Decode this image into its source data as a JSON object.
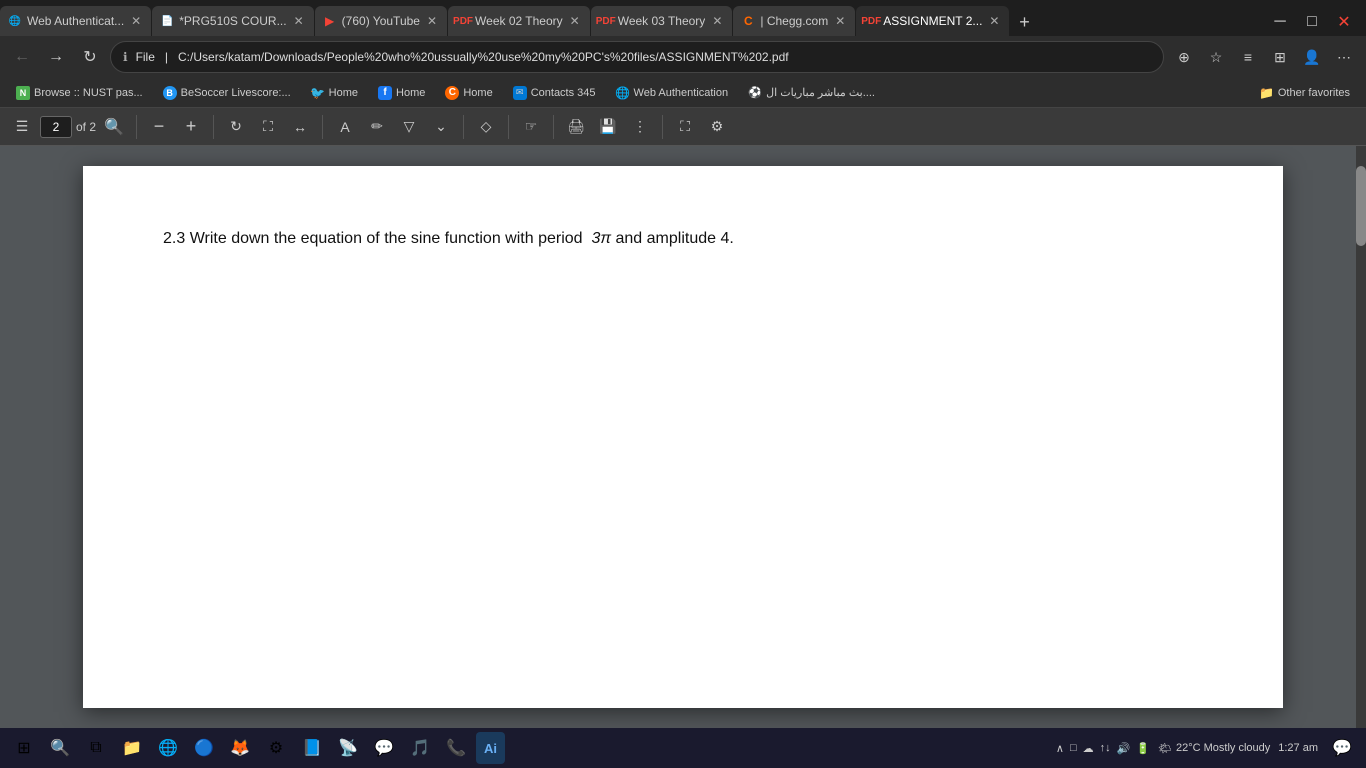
{
  "browser": {
    "tabs": [
      {
        "id": "tab1",
        "label": "Web Authenticat...",
        "icon": "🌐",
        "icon_color": "#4caf50",
        "active": false,
        "closable": true
      },
      {
        "id": "tab2",
        "label": "*PRG510S COUR...",
        "icon": "📄",
        "icon_color": "#aaa",
        "active": false,
        "closable": true
      },
      {
        "id": "tab3",
        "label": "(760) YouTube",
        "icon": "▶",
        "icon_color": "#f44336",
        "active": false,
        "closable": true
      },
      {
        "id": "tab4",
        "label": "Week 02 Theory",
        "icon": "PDF",
        "icon_color": "#f44336",
        "active": false,
        "closable": true
      },
      {
        "id": "tab5",
        "label": "Week 03 Theory",
        "icon": "PDF",
        "icon_color": "#f44336",
        "active": false,
        "closable": true
      },
      {
        "id": "tab6",
        "label": "| Chegg.com",
        "icon": "C",
        "icon_color": "#ff6600",
        "active": false,
        "closable": true
      },
      {
        "id": "tab7",
        "label": "ASSIGNMENT 2...",
        "icon": "PDF",
        "icon_color": "#f44336",
        "active": true,
        "closable": true
      }
    ],
    "url": "C:/Users/katam/Downloads/People%20who%20ussually%20use%20my%20PC's%20files/ASSIGNMENT%202.pdf",
    "url_display": "File   |   C:/Users/katam/Downloads/People%20who%20ussually%20use%20my%20PC's%20files/ASSIGNMENT%202.pdf"
  },
  "bookmarks": [
    {
      "label": "Browse :: NUST pas...",
      "icon": "N",
      "color": "#4caf50"
    },
    {
      "label": "BeSoccer Livescore:...",
      "icon": "B",
      "color": "#2196f3"
    },
    {
      "label": "Home",
      "icon": "🐦",
      "color": "#1da1f2"
    },
    {
      "label": "Home",
      "icon": "f",
      "color": "#1877f2"
    },
    {
      "label": "Home",
      "icon": "C",
      "color": "#ff6600"
    },
    {
      "label": "Contacts 345",
      "icon": "📧",
      "color": "#0078d4"
    },
    {
      "label": "Web Authentication",
      "icon": "🌐",
      "color": "#4caf50"
    },
    {
      "label": "بث مباشر مباريات ال....",
      "icon": "⚽",
      "color": "#4caf50"
    },
    {
      "label": "Other favorites",
      "icon": "📁",
      "color": "#f9a825"
    }
  ],
  "pdf_viewer": {
    "current_page": "2",
    "total_pages": "of 2",
    "zoom_minus": "−",
    "zoom_plus": "+",
    "content": {
      "question_number": "2.3",
      "question_text": "Write down the equation of the sine function with period ",
      "period_value": "3π",
      "question_end": " and amplitude 4."
    }
  },
  "taskbar": {
    "start_icon": "⊞",
    "search_icon": "🔍",
    "task_view": "⧉",
    "pinned_apps": [
      "📁",
      "🌐",
      "🔵",
      "🦊",
      "⚙",
      "📘",
      "📡",
      "💬",
      "🎵",
      "📞"
    ],
    "ai_label": "Ai",
    "weather": "22°C  Mostly cloudy",
    "time": "1:27 am",
    "date": "",
    "system_tray": "∧  □  ☁  ↑↓  🔊"
  }
}
